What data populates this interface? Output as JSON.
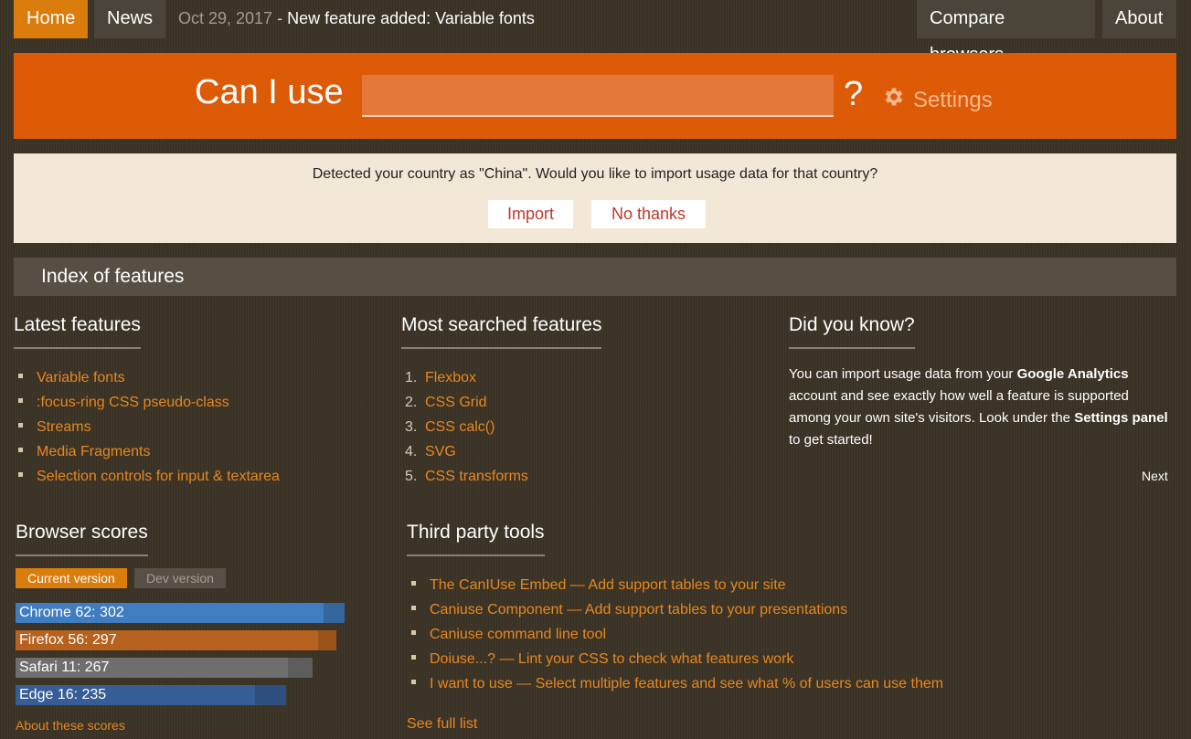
{
  "nav": {
    "home": "Home",
    "news": "News",
    "news_date": "Oct 29, 2017",
    "news_sep": " - ",
    "news_title": "New feature added: Variable fonts",
    "compare": "Compare browsers",
    "about": "About"
  },
  "search": {
    "label": "Can I use",
    "value": "",
    "qmark": "?",
    "settings": "Settings",
    "settings_icon": "gear-icon"
  },
  "notice": {
    "text": "Detected your country as \"China\". Would you like to import usage data for that country?",
    "import": "Import",
    "no_thanks": "No thanks"
  },
  "index": {
    "title": "Index of features"
  },
  "latest": {
    "heading": "Latest features",
    "items": [
      "Variable fonts",
      ":focus-ring CSS pseudo-class",
      "Streams",
      "Media Fragments",
      "Selection controls for input & textarea"
    ]
  },
  "most_searched": {
    "heading": "Most searched features",
    "items": [
      {
        "num": "1.",
        "label": "Flexbox"
      },
      {
        "num": "2.",
        "label": "CSS Grid"
      },
      {
        "num": "3.",
        "label": "CSS calc()"
      },
      {
        "num": "4.",
        "label": "SVG"
      },
      {
        "num": "5.",
        "label": "CSS transforms"
      }
    ]
  },
  "did_you_know": {
    "heading": "Did you know?",
    "t1": "You can import usage data from your ",
    "b1": "Google Analytics",
    "t2": " account and see exactly how well a feature is supported among your own site's visitors. Look under the ",
    "b2": "Settings panel",
    "t3": " to get started!",
    "next": "Next"
  },
  "browser_scores": {
    "heading": "Browser scores",
    "tab_current": "Current version",
    "tab_dev": "Dev version",
    "scores": [
      {
        "label": "Chrome 62: 302",
        "score": 302,
        "max_score": 323,
        "color": "#3f7cc0",
        "track_color": "#35679e"
      },
      {
        "label": "Firefox 56: 297",
        "score": 297,
        "max_score": 315,
        "color": "#b6611d",
        "track_color": "#9c531a"
      },
      {
        "label": "Safari 11: 267",
        "score": 267,
        "max_score": 292,
        "color": "#6e6e6e",
        "track_color": "#5d5d5d"
      },
      {
        "label": "Edge 16: 235",
        "score": 235,
        "max_score": 266,
        "color": "#365d96",
        "track_color": "#2f4f7e"
      }
    ],
    "about": "About these scores"
  },
  "third_party": {
    "heading": "Third party tools",
    "items": [
      "The CanIUse Embed — Add support tables to your site",
      "Caniuse Component — Add support tables to your presentations",
      "Caniuse command line tool",
      "Doiuse...? — Lint your CSS to check what features work",
      "I want to use — Select multiple features and see what % of users can use them"
    ],
    "see_full": "See full list"
  }
}
